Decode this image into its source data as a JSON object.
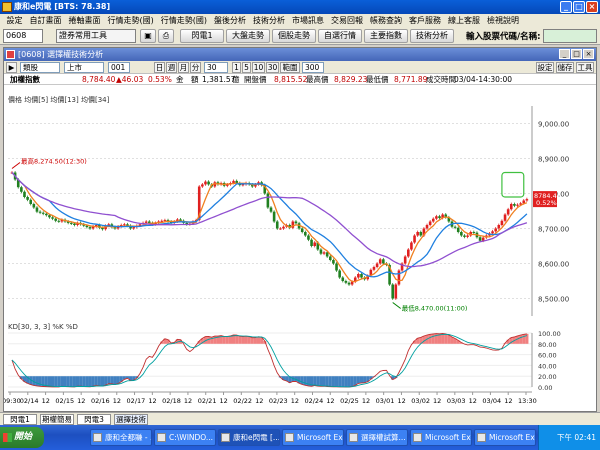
{
  "window": {
    "title": "康和e閃電 [BTS: 78.38]"
  },
  "menu": [
    "設定",
    "自訂畫面",
    "捲軸畫面",
    "行情走勢(國)",
    "行情走勢(國)",
    "盤後分析",
    "技術分析",
    "市場訊息",
    "交易回報",
    "帳務查詢",
    "客戶服務",
    "線上客服",
    "檢視說明"
  ],
  "toolbar": {
    "code": "0608",
    "tools": "證券常用工具",
    "buttons": [
      "閃電1",
      "大盤走勢",
      "個股走勢",
      "自選行情",
      "主要指數",
      "技術分析"
    ],
    "search_label": "輸入股票代碼/名稱:",
    "search_value": ""
  },
  "chart_window": {
    "title": "[0608] 選擇權技術分析",
    "right_buttons": [
      "設定",
      "儲存",
      "工具"
    ]
  },
  "controls": {
    "type": "類股",
    "market": "上市",
    "code": "001",
    "periods": [
      "日",
      "週",
      "月",
      "分"
    ],
    "interval": "30",
    "ranges": [
      "1",
      "5",
      "10",
      "30"
    ],
    "zoom_label": "範圍",
    "count": "300"
  },
  "info": {
    "name": "加權指數",
    "price": "8,784.40",
    "change": "▲46.03",
    "pct": "0.53%",
    "vol_label": "金　額",
    "vol": "1,381.57",
    "unit": "億",
    "open_label": "開盤價",
    "open": "8,815.52",
    "high_label": "最高價",
    "high": "8,829.23",
    "low_label": "最低價",
    "low": "8,771.89",
    "time_label": "成交時間",
    "time": "03/04-14:30:00"
  },
  "legend_price": "價格  均價[5]  均價[13]  均價[34]",
  "legend_kd": "KD[30, 3, 3]  %K  %D",
  "annotations": {
    "high": "最高8,274.50(12:30)",
    "low": "最低8,470.00(11:00)",
    "last_price": "8784.40",
    "last_pct": "0.52%"
  },
  "kd_axis": [
    "100.00",
    "80.00",
    "60.00",
    "40.00",
    "20.00",
    "0.00"
  ],
  "time_axis": [
    "09:30",
    "02/14",
    "12",
    "02/15",
    "12",
    "02/16",
    "12",
    "02/17",
    "12",
    "02/18",
    "12",
    "02/21",
    "12",
    "02/22",
    "12",
    "02/23",
    "12",
    "02/24",
    "12",
    "02/25",
    "12",
    "03/01",
    "12",
    "03/02",
    "12",
    "03/03",
    "12",
    "03/04",
    "12",
    "13:30"
  ],
  "bottom_tabs": [
    "閃電1",
    "期權簡易",
    "閃電3",
    "選擇技術"
  ],
  "taskbar": {
    "start": "開始",
    "tasks": [
      "康和全都賺 - ...",
      "C:\\WINDO...",
      "康和e閃電 [...",
      "Microsoft Exc...",
      "選擇權試算...",
      "Microsoft Exc...",
      "Microsoft Exc..."
    ],
    "clock": "下午 02:41"
  },
  "colors": {
    "up": "#e02020",
    "down": "#208020",
    "ma5": "#f08020",
    "ma13": "#2080e0",
    "ma34": "#9050d0",
    "k": "#c03030",
    "d": "#00a0a0"
  },
  "chart_data": {
    "type": "candlestick",
    "ylim": [
      8450,
      9050
    ],
    "yticks": [
      9000,
      8900,
      8800,
      8700,
      8600,
      8500
    ],
    "closes": [
      8860,
      8840,
      8818,
      8805,
      8790,
      8782,
      8770,
      8760,
      8748,
      8745,
      8742,
      8738,
      8732,
      8728,
      8722,
      8720,
      8725,
      8720,
      8716,
      8714,
      8710,
      8716,
      8712,
      8708,
      8704,
      8700,
      8706,
      8710,
      8702,
      8698,
      8708,
      8712,
      8704,
      8700,
      8706,
      8710,
      8712,
      8708,
      8700,
      8704,
      8708,
      8712,
      8716,
      8720,
      8716,
      8712,
      8716,
      8720,
      8722,
      8724,
      8720,
      8716,
      8720,
      8726,
      8722,
      8716,
      8712,
      8714,
      8720,
      8724,
      8820,
      8826,
      8834,
      8826,
      8820,
      8832,
      8826,
      8830,
      8822,
      8826,
      8830,
      8836,
      8830,
      8824,
      8826,
      8830,
      8826,
      8820,
      8826,
      8832,
      8824,
      8800,
      8760,
      8748,
      8720,
      8700,
      8700,
      8705,
      8710,
      8702,
      8720,
      8715,
      8700,
      8690,
      8680,
      8668,
      8650,
      8660,
      8640,
      8628,
      8632,
      8620,
      8610,
      8600,
      8580,
      8560,
      8550,
      8545,
      8540,
      8548,
      8560,
      8570,
      8560,
      8555,
      8565,
      8582,
      8590,
      8600,
      8612,
      8600,
      8596,
      8540,
      8500,
      8540,
      8580,
      8600,
      8620,
      8640,
      8660,
      8680,
      8690,
      8680,
      8700,
      8710,
      8720,
      8728,
      8735,
      8730,
      8740,
      8732,
      8720,
      8705,
      8702,
      8690,
      8680,
      8676,
      8680,
      8690,
      8688,
      8675,
      8665,
      8674,
      8680,
      8686,
      8692,
      8700,
      8710,
      8722,
      8740,
      8755,
      8770,
      8765,
      8768,
      8772,
      8780,
      8784
    ]
  }
}
